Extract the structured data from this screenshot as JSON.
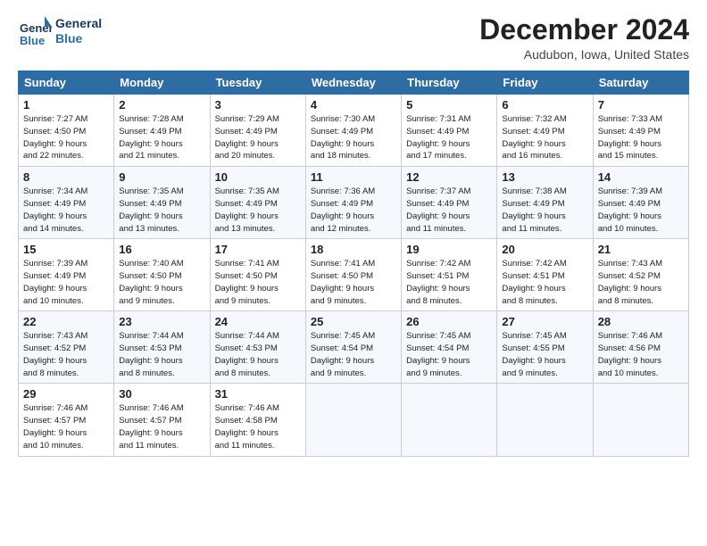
{
  "header": {
    "logo_line1": "General",
    "logo_line2": "Blue",
    "title": "December 2024",
    "subtitle": "Audubon, Iowa, United States"
  },
  "days_of_week": [
    "Sunday",
    "Monday",
    "Tuesday",
    "Wednesday",
    "Thursday",
    "Friday",
    "Saturday"
  ],
  "weeks": [
    [
      {
        "num": "1",
        "rise": "7:27 AM",
        "set": "4:50 PM",
        "daylight": "9 hours and 22 minutes."
      },
      {
        "num": "2",
        "rise": "7:28 AM",
        "set": "4:49 PM",
        "daylight": "9 hours and 21 minutes."
      },
      {
        "num": "3",
        "rise": "7:29 AM",
        "set": "4:49 PM",
        "daylight": "9 hours and 20 minutes."
      },
      {
        "num": "4",
        "rise": "7:30 AM",
        "set": "4:49 PM",
        "daylight": "9 hours and 18 minutes."
      },
      {
        "num": "5",
        "rise": "7:31 AM",
        "set": "4:49 PM",
        "daylight": "9 hours and 17 minutes."
      },
      {
        "num": "6",
        "rise": "7:32 AM",
        "set": "4:49 PM",
        "daylight": "9 hours and 16 minutes."
      },
      {
        "num": "7",
        "rise": "7:33 AM",
        "set": "4:49 PM",
        "daylight": "9 hours and 15 minutes."
      }
    ],
    [
      {
        "num": "8",
        "rise": "7:34 AM",
        "set": "4:49 PM",
        "daylight": "9 hours and 14 minutes."
      },
      {
        "num": "9",
        "rise": "7:35 AM",
        "set": "4:49 PM",
        "daylight": "9 hours and 13 minutes."
      },
      {
        "num": "10",
        "rise": "7:35 AM",
        "set": "4:49 PM",
        "daylight": "9 hours and 13 minutes."
      },
      {
        "num": "11",
        "rise": "7:36 AM",
        "set": "4:49 PM",
        "daylight": "9 hours and 12 minutes."
      },
      {
        "num": "12",
        "rise": "7:37 AM",
        "set": "4:49 PM",
        "daylight": "9 hours and 11 minutes."
      },
      {
        "num": "13",
        "rise": "7:38 AM",
        "set": "4:49 PM",
        "daylight": "9 hours and 11 minutes."
      },
      {
        "num": "14",
        "rise": "7:39 AM",
        "set": "4:49 PM",
        "daylight": "9 hours and 10 minutes."
      }
    ],
    [
      {
        "num": "15",
        "rise": "7:39 AM",
        "set": "4:49 PM",
        "daylight": "9 hours and 10 minutes."
      },
      {
        "num": "16",
        "rise": "7:40 AM",
        "set": "4:50 PM",
        "daylight": "9 hours and 9 minutes."
      },
      {
        "num": "17",
        "rise": "7:41 AM",
        "set": "4:50 PM",
        "daylight": "9 hours and 9 minutes."
      },
      {
        "num": "18",
        "rise": "7:41 AM",
        "set": "4:50 PM",
        "daylight": "9 hours and 9 minutes."
      },
      {
        "num": "19",
        "rise": "7:42 AM",
        "set": "4:51 PM",
        "daylight": "9 hours and 8 minutes."
      },
      {
        "num": "20",
        "rise": "7:42 AM",
        "set": "4:51 PM",
        "daylight": "9 hours and 8 minutes."
      },
      {
        "num": "21",
        "rise": "7:43 AM",
        "set": "4:52 PM",
        "daylight": "9 hours and 8 minutes."
      }
    ],
    [
      {
        "num": "22",
        "rise": "7:43 AM",
        "set": "4:52 PM",
        "daylight": "9 hours and 8 minutes."
      },
      {
        "num": "23",
        "rise": "7:44 AM",
        "set": "4:53 PM",
        "daylight": "9 hours and 8 minutes."
      },
      {
        "num": "24",
        "rise": "7:44 AM",
        "set": "4:53 PM",
        "daylight": "9 hours and 8 minutes."
      },
      {
        "num": "25",
        "rise": "7:45 AM",
        "set": "4:54 PM",
        "daylight": "9 hours and 9 minutes."
      },
      {
        "num": "26",
        "rise": "7:45 AM",
        "set": "4:54 PM",
        "daylight": "9 hours and 9 minutes."
      },
      {
        "num": "27",
        "rise": "7:45 AM",
        "set": "4:55 PM",
        "daylight": "9 hours and 9 minutes."
      },
      {
        "num": "28",
        "rise": "7:46 AM",
        "set": "4:56 PM",
        "daylight": "9 hours and 10 minutes."
      }
    ],
    [
      {
        "num": "29",
        "rise": "7:46 AM",
        "set": "4:57 PM",
        "daylight": "9 hours and 10 minutes."
      },
      {
        "num": "30",
        "rise": "7:46 AM",
        "set": "4:57 PM",
        "daylight": "9 hours and 11 minutes."
      },
      {
        "num": "31",
        "rise": "7:46 AM",
        "set": "4:58 PM",
        "daylight": "9 hours and 11 minutes."
      },
      null,
      null,
      null,
      null
    ]
  ],
  "labels": {
    "sunrise": "Sunrise:",
    "sunset": "Sunset:",
    "daylight": "Daylight:"
  }
}
